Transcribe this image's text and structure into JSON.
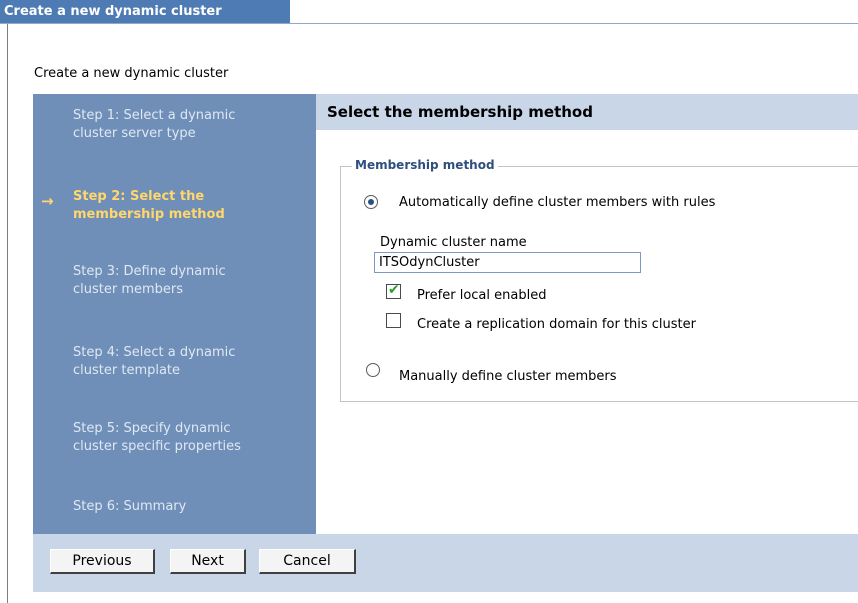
{
  "window": {
    "title": "Create a new dynamic cluster"
  },
  "page": {
    "heading": "Create a new dynamic cluster"
  },
  "steps": [
    {
      "label": "Step 1: Select a dynamic cluster server type",
      "active": false
    },
    {
      "label": "Step 2: Select the membership method",
      "active": true
    },
    {
      "label": "Step 3: Define dynamic cluster members",
      "active": false
    },
    {
      "label": "Step 4: Select a dynamic cluster template",
      "active": false
    },
    {
      "label": "Step 5: Specify dynamic cluster specific properties",
      "active": false
    },
    {
      "label": "Step 6: Summary",
      "active": false
    }
  ],
  "current_step_arrow": "→",
  "content": {
    "title": "Select the membership method",
    "group_legend": "Membership method",
    "option_auto": {
      "label": "Automatically define cluster members with rules",
      "selected": true
    },
    "cluster_name_label": "Dynamic cluster name",
    "cluster_name_value": "ITSOdynCluster",
    "prefer_local": {
      "label": "Prefer local enabled",
      "checked": true
    },
    "replication_domain": {
      "label": "Create a replication domain for this cluster",
      "checked": false
    },
    "option_manual": {
      "label": "Manually define cluster members",
      "selected": false
    }
  },
  "buttons": {
    "previous": "Previous",
    "next": "Next",
    "cancel": "Cancel"
  },
  "colors": {
    "title_bar": "#4e7bb3",
    "steps_panel": "#6f8fb8",
    "active_step": "#ffd76b",
    "header_band": "#c8d6e8",
    "legend_text": "#2e4f7d",
    "checkmark": "#2c9e2c"
  }
}
